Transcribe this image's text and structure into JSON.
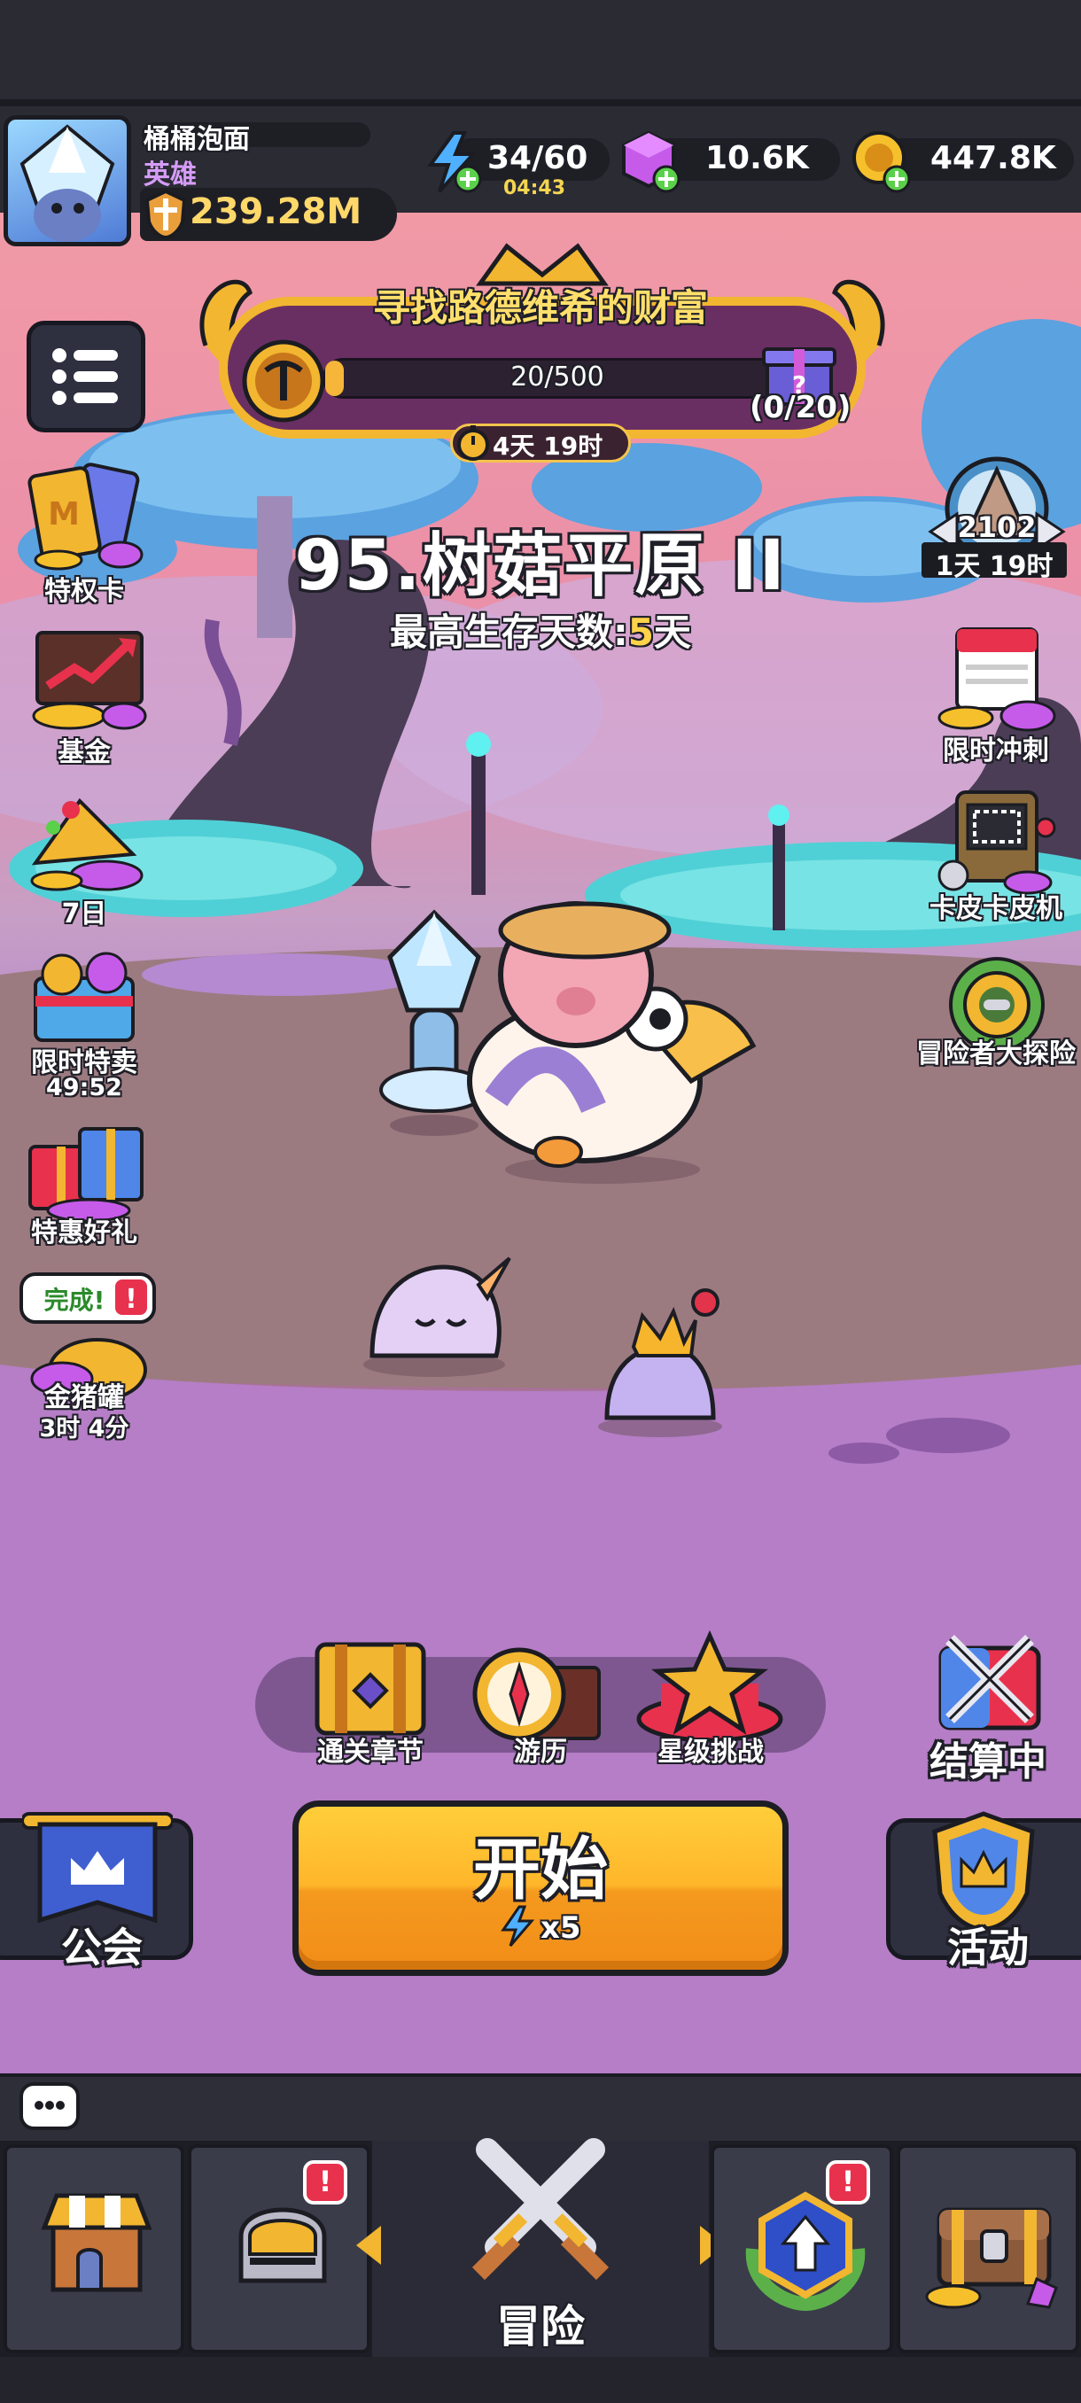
{
  "player": {
    "name": "桶桶泡面",
    "rank": "英雄",
    "power": "239.28M"
  },
  "resources": {
    "energy": "34/60",
    "energy_timer": "04:43",
    "gems": "10.6K",
    "gold": "447.8K"
  },
  "event": {
    "title": "寻找路德维希的财富",
    "progress": "20/500",
    "progress_fraction": 0.04,
    "reward_count": "(0/20)",
    "timer": "4天 19时"
  },
  "stage": {
    "name": "95.树菇平原 II",
    "survival_label": "最高生存天数:",
    "survival_value": "5",
    "survival_unit": "天"
  },
  "left_menu": {
    "items": [
      {
        "label": "特权卡",
        "icon": "privilege-card-icon"
      },
      {
        "label": "基金",
        "icon": "fund-chart-icon"
      },
      {
        "label": "7日",
        "icon": "seven-day-gift-icon"
      },
      {
        "label": "限时特卖",
        "sub": "49:52",
        "icon": "limited-sale-icon"
      },
      {
        "label": "特惠好礼",
        "icon": "discount-gift-icon"
      },
      {
        "label": "金猪罐",
        "sub": "3时 4分",
        "tag": "完成!",
        "icon": "piggy-bank-icon"
      }
    ]
  },
  "right_menu": {
    "rank_value": "2102",
    "rank_timer": "1天 19时",
    "items": [
      {
        "label": "限时冲刺",
        "icon": "calendar-sprint-icon"
      },
      {
        "label": "卡皮卡皮机",
        "icon": "slot-machine-icon"
      },
      {
        "label": "冒险者大探险",
        "icon": "adventurer-compass-icon"
      }
    ]
  },
  "actions": {
    "chapter": "通关章节",
    "journey": "游历",
    "star_challenge": "星级挑战",
    "settling": "结算中"
  },
  "start": {
    "label": "开始",
    "cost": "x5"
  },
  "guild": {
    "label": "公会"
  },
  "activity": {
    "label": "活动"
  },
  "nav": {
    "adventure": "冒险"
  },
  "colors": {
    "accent_gold": "#ffb62a",
    "badge_red": "#e8314d",
    "highlight_yellow": "#ffd34a"
  }
}
